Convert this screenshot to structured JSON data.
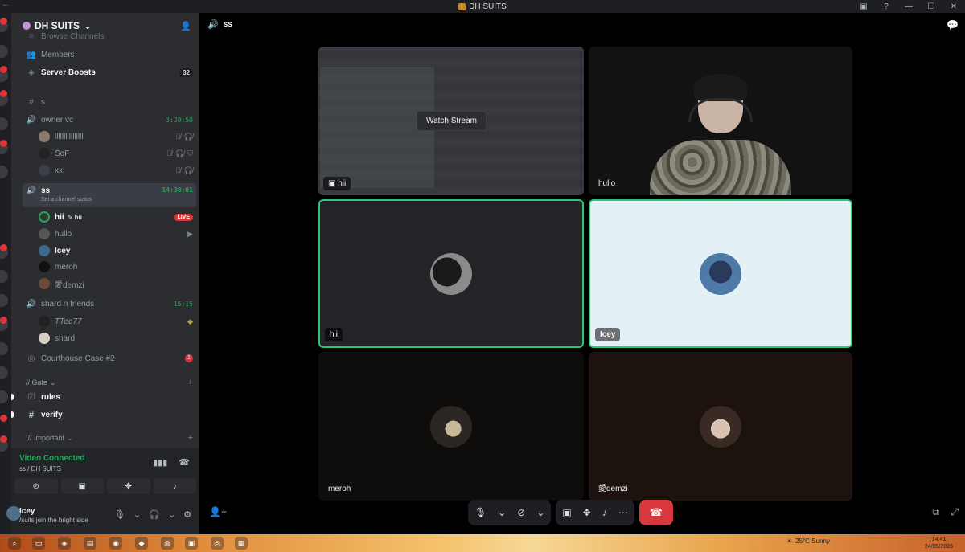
{
  "window": {
    "title": "DH SUITS"
  },
  "server": {
    "name": "DH SUITS"
  },
  "sidebar": {
    "browse_channels": "Browse Channels",
    "members": "Members",
    "server_boosts": "Server Boosts",
    "server_boosts_count": "32",
    "text_channel_s": "s",
    "voice_owner": {
      "name": "owner vc",
      "timer": "3:20:50",
      "users": [
        "llllllllllllllll",
        "SoF",
        "xx"
      ]
    },
    "voice_ss": {
      "name": "ss",
      "timer": "14:38:01",
      "status_hint": "Set a channel status",
      "users": [
        {
          "name": "hii",
          "extra": "hii",
          "badge": "LIVE"
        },
        {
          "name": "hullo"
        },
        {
          "name": "Icey"
        },
        {
          "name": "meroh"
        },
        {
          "name": "愛demzi"
        }
      ]
    },
    "voice_shard": {
      "name": "shard n friends",
      "timer": "15:15",
      "users": [
        "TTee77",
        "shard"
      ]
    },
    "forum": {
      "name": "Courthouse Case #2",
      "badge": "1"
    },
    "category_gate": "// Gate",
    "rules": "rules",
    "verify": "verify",
    "category_important": "!// Important"
  },
  "voice_panel": {
    "status": "Video Connected",
    "location": "ss / DH SUITS"
  },
  "user_panel": {
    "name": "Icey",
    "status": "/suits join the bright side"
  },
  "call": {
    "channel": "ss",
    "watch_stream": "Watch Stream",
    "tiles": {
      "stream_label": "hii",
      "hullo": "hullo",
      "hii": "hii",
      "icey": "Icey",
      "meroh": "meroh",
      "demzi": "愛demzi"
    }
  },
  "taskbar": {
    "weather": "25°C  Sunny",
    "time": "14:41",
    "date": "24/05/2026"
  }
}
